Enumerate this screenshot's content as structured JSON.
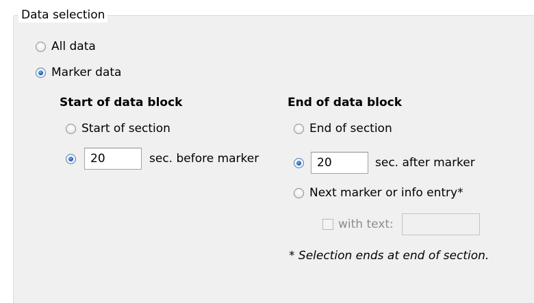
{
  "group": {
    "legend": "Data selection"
  },
  "scope": {
    "all_data": "All data",
    "marker_data": "Marker data",
    "selected": "marker_data"
  },
  "start_block": {
    "heading": "Start of data block",
    "start_of_section": "Start of section",
    "seconds_value": "20",
    "seconds_suffix": "sec. before marker",
    "selected": "seconds"
  },
  "end_block": {
    "heading": "End of data block",
    "end_of_section": "End of section",
    "seconds_value": "20",
    "seconds_suffix": "sec. after marker",
    "next_marker": "Next marker or info entry*",
    "with_text_label": "with text:",
    "with_text_value": "",
    "with_text_checked": false,
    "selected": "seconds"
  },
  "footnote": "* Selection ends at end of section."
}
